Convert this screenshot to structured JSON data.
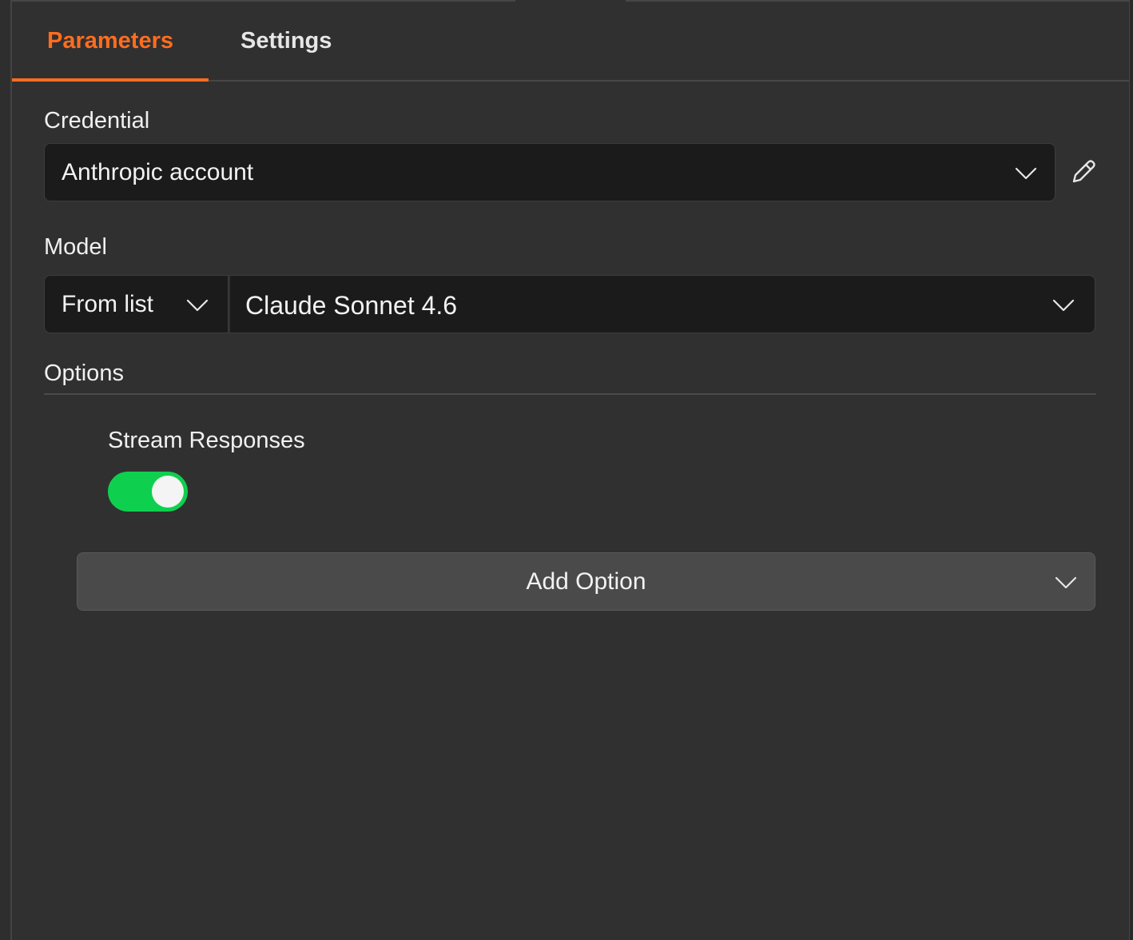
{
  "tabs": [
    {
      "label": "Parameters",
      "active": true
    },
    {
      "label": "Settings",
      "active": false
    }
  ],
  "credential": {
    "label": "Credential",
    "selected": "Anthropic account",
    "edit_icon": "pencil-icon"
  },
  "model": {
    "label": "Model",
    "mode": "From list",
    "selected": "Claude Sonnet 4.6"
  },
  "options": {
    "label": "Options",
    "items": [
      {
        "label": "Stream Responses",
        "enabled": true
      }
    ],
    "add_label": "Add Option"
  },
  "colors": {
    "accent": "#ff6d1f",
    "toggle_on": "#0fcf4f",
    "background": "#303030",
    "input_bg": "#1b1b1b"
  }
}
